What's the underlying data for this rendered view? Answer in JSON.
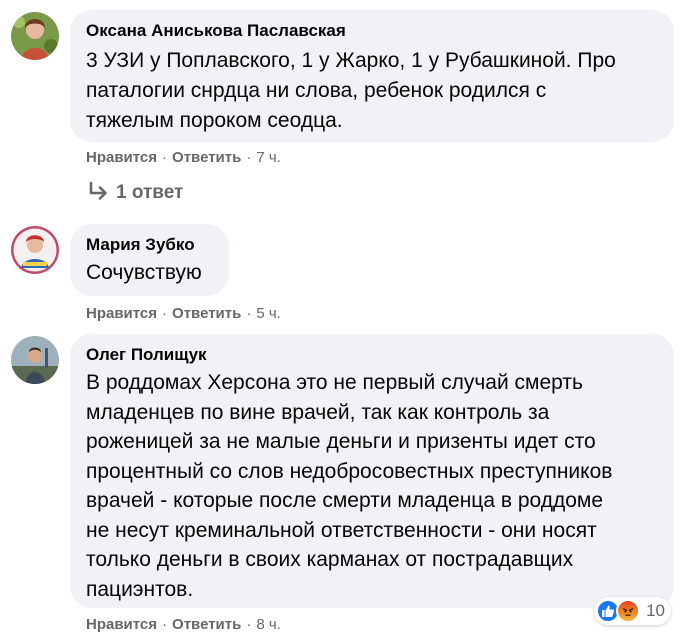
{
  "comments": [
    {
      "author": "Оксана Аниськова Паславская",
      "text": "3 УЗИ у Поплавского, 1 у Жарко, 1 у Рубашкиной. Про\nпаталогии снрдца ни слова, ребенок родился с\nтяжелым пороком сеодца.",
      "like_label": "Нравится",
      "reply_label": "Ответить",
      "time": "7 ч.",
      "replies_label": "1 ответ",
      "avatar_color": "#7a9a4a"
    },
    {
      "author": "Мария Зубко",
      "text": "Сочувствую",
      "like_label": "Нравится",
      "reply_label": "Ответить",
      "time": "5 ч.",
      "avatar_color": "#c04a6a"
    },
    {
      "author": "Олег Полищук",
      "text": "В роддомах Херсона это не первый случай смерть\nмладенцев по вине врачей, так как контроль за\nроженицей за не малые деньги и призенты идет сто\nпроцентный со слов недобросовестных преступников\nврачей - которые после смерти младенца в роддоме\nне несут креминальной ответственности - они носят\nтолько деньги в своих карманах от пострадавщих\nпациэнтов.",
      "like_label": "Нравится",
      "reply_label": "Ответить",
      "time": "8 ч.",
      "reaction_count": "10",
      "avatar_color": "#6f7f8a"
    }
  ],
  "separator": "·",
  "colors": {
    "bubble": "#f0f2f5",
    "meta_text": "#65676b",
    "like_blue": "#1877f2",
    "angry_orange": "#f0703a"
  },
  "icons": {
    "reply_arrow": "reply-arrow-icon",
    "like_reaction": "like-reaction-icon",
    "angry_reaction": "angry-reaction-icon"
  }
}
